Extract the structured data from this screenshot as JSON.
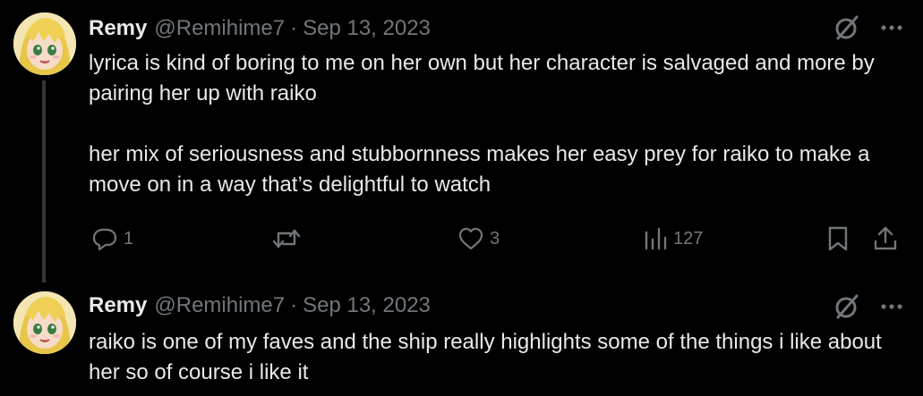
{
  "tweets": [
    {
      "author_name": "Remy",
      "handle": "@Remihime7",
      "separator": "·",
      "date": "Sep 13, 2023",
      "paragraphs": [
        "lyrica is kind of boring to me on her own but her character is salvaged and more by pairing her up with raiko",
        "her mix of seriousness and stubbornness makes her easy prey for raiko to make a move on in a way that’s delightful to watch"
      ],
      "actions": {
        "replies": "1",
        "retweets": "",
        "likes": "3",
        "views": "127"
      }
    },
    {
      "author_name": "Remy",
      "handle": "@Remihime7",
      "separator": "·",
      "date": "Sep 13, 2023",
      "paragraphs": [
        "raiko is one of my faves and the ship really highlights some of the things i like about her so of course i like it"
      ]
    }
  ],
  "icons": {
    "grok": "grok-icon",
    "more": "more-icon",
    "reply": "reply-icon",
    "retweet": "retweet-icon",
    "like": "like-icon",
    "views": "views-icon",
    "bookmark": "bookmark-icon",
    "share": "share-icon"
  },
  "colors": {
    "background": "#000000",
    "text": "#e7e9ea",
    "muted": "#71767b",
    "thread_line": "#333639"
  }
}
